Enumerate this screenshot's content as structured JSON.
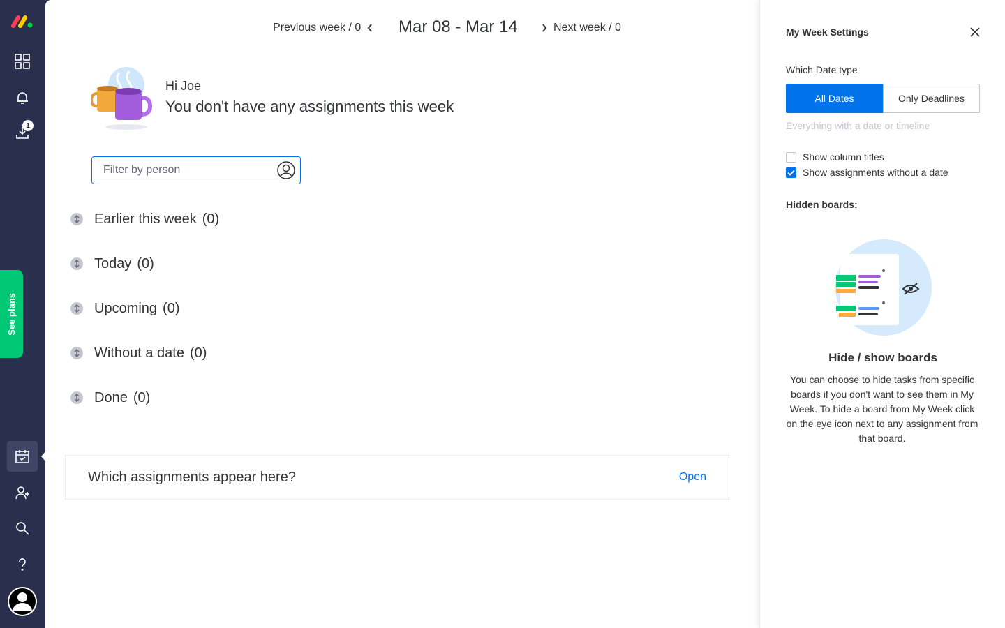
{
  "rail": {
    "notifications_badge": "1",
    "see_plans_label": "See plans"
  },
  "week_nav": {
    "prev_label": "Previous week / 0",
    "range": "Mar 08 - Mar 14",
    "next_label": "Next week / 0"
  },
  "greeting": {
    "hi": "Hi Joe",
    "message": "You don't have any assignments this week"
  },
  "filter": {
    "placeholder": "Filter by person"
  },
  "groups": [
    {
      "title": "Earlier this week",
      "count": "(0)"
    },
    {
      "title": "Today",
      "count": "(0)"
    },
    {
      "title": "Upcoming",
      "count": "(0)"
    },
    {
      "title": "Without a date",
      "count": "(0)"
    },
    {
      "title": "Done",
      "count": "(0)"
    }
  ],
  "faq": {
    "question": "Which assignments appear here?",
    "open_label": "Open"
  },
  "settings": {
    "title": "My Week Settings",
    "date_type_label": "Which Date type",
    "seg_all": "All Dates",
    "seg_deadlines": "Only Deadlines",
    "seg_hint": "Everything with a date or timeline",
    "show_column_titles": "Show column titles",
    "show_column_titles_checked": false,
    "show_without_date": "Show assignments without a date",
    "show_without_date_checked": true,
    "hidden_boards_label": "Hidden boards:",
    "illus_title": "Hide / show boards",
    "illus_desc": "You can choose to hide tasks from specific boards if you don't want to see them in My Week. To hide a board from My Week click on the eye icon next to any assignment from that board."
  },
  "colors": {
    "rail_bg": "#292f4c",
    "primary": "#0073ea",
    "see_plans": "#00c875"
  }
}
